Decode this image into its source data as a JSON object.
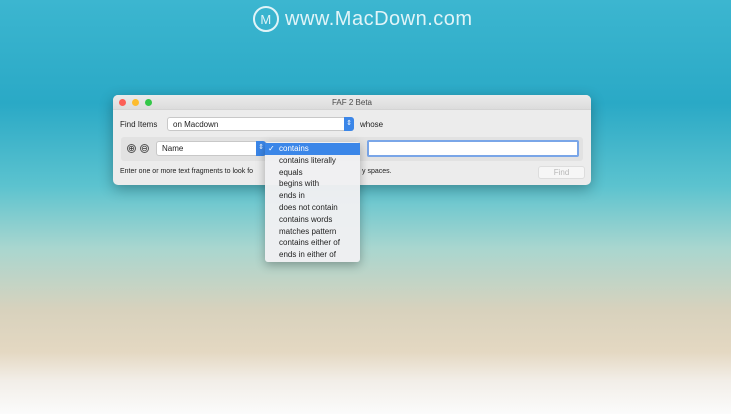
{
  "watermark": {
    "text": "www.MacDown.com",
    "logo": "M"
  },
  "window": {
    "title": "FAF 2 Beta",
    "traffic": {
      "close": "#fc5f57",
      "minimize": "#fdbc2e",
      "zoom": "#33c748"
    }
  },
  "find_row": {
    "label": "Find Items",
    "location": "on Macdown",
    "suffix": "whose"
  },
  "criteria": {
    "attribute": "Name",
    "add_icon": "⊕",
    "remove_icon": "⊖",
    "value": ""
  },
  "help_text": {
    "part1": "Enter one or more text fragments to look fo",
    "part2": "y spaces."
  },
  "find_button": "Find",
  "menu": {
    "selected_index": 0,
    "check": "✓",
    "items": [
      "contains",
      "contains literally",
      "equals",
      "begins with",
      "ends in",
      "does not contain",
      "contains words",
      "matches pattern",
      "contains either of",
      "ends in either of"
    ]
  }
}
